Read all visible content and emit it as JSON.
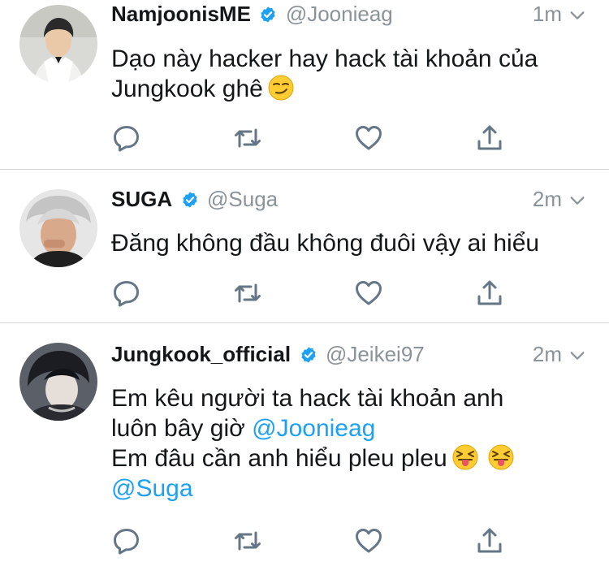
{
  "tweets": [
    {
      "name": "NamjoonisME",
      "handle": "@Joonieag",
      "time": "1m",
      "line1": "Dạo này hacker hay hack tài khoản của",
      "line2": "Jungkook ghê"
    },
    {
      "name": "SUGA",
      "handle": "@Suga",
      "time": "2m",
      "line1": "Đăng không đầu không đuôi vậy ai hiểu"
    },
    {
      "name": "Jungkook_official",
      "handle": "@Jeikei97",
      "time": "2m",
      "line1": "Em kêu người ta hack tài khoản anh",
      "line2": "luôn bây giờ",
      "mention1": "@Joonieag",
      "line3": "Em đâu cần anh hiểu pleu pleu",
      "mention2": "@Suga"
    }
  ],
  "icons": {
    "verified": "verified-badge-icon",
    "menu": "chevron-down-icon",
    "reply": "reply-icon",
    "retweet": "retweet-icon",
    "like": "heart-icon",
    "share": "share-icon",
    "emoji_smirk": "smirking-face-emoji",
    "emoji_tongue": "squinting-tongue-face-emoji"
  },
  "colors": {
    "verified": "#1da1f2",
    "mention": "#1da1f2",
    "meta_text": "#8a9399",
    "action_icon": "#657786",
    "divider": "#d6d6da"
  }
}
